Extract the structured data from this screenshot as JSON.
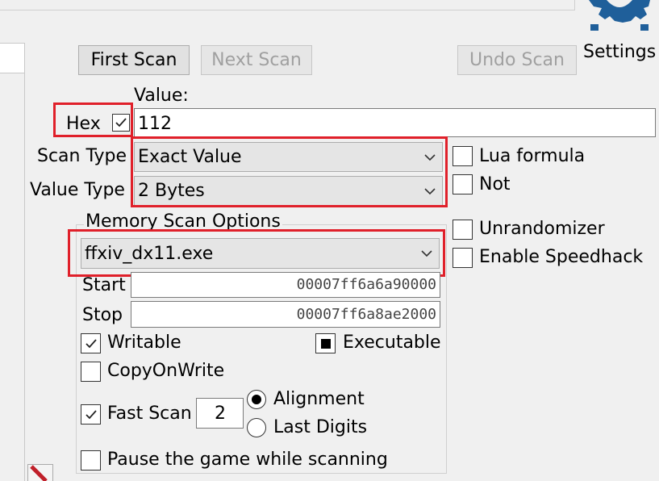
{
  "buttons": {
    "first_scan": "First Scan",
    "next_scan": "Next Scan",
    "undo_scan": "Undo Scan",
    "settings": "Settings"
  },
  "value": {
    "label": "Value:",
    "hex_label": "Hex",
    "hex_checked": true,
    "input": "112"
  },
  "scan_type": {
    "label": "Scan Type",
    "selected": "Exact Value"
  },
  "value_type": {
    "label": "Value Type",
    "selected": "2 Bytes"
  },
  "right_options": {
    "lua_formula": "Lua formula",
    "not": "Not",
    "unrandomizer": "Unrandomizer",
    "enable_speedhack": "Enable Speedhack"
  },
  "memory_scan_options": {
    "title": "Memory Scan Options",
    "process": "ffxiv_dx11.exe",
    "start_label": "Start",
    "start_value": "00007ff6a6a90000",
    "stop_label": "Stop",
    "stop_value": "00007ff6a8ae2000",
    "writable": "Writable",
    "executable": "Executable",
    "copy_on_write": "CopyOnWrite",
    "fast_scan": "Fast Scan",
    "fast_scan_value": "2",
    "alignment": "Alignment",
    "last_digits": "Last Digits",
    "pause_game": "Pause the game while scanning"
  },
  "colors": {
    "highlight": "#e0202a",
    "settings_icon": "#1f5f9a"
  },
  "icons": [
    "settings-gear-icon",
    "chevron-down-icon",
    "checkmark-icon",
    "radio-dot-icon"
  ]
}
